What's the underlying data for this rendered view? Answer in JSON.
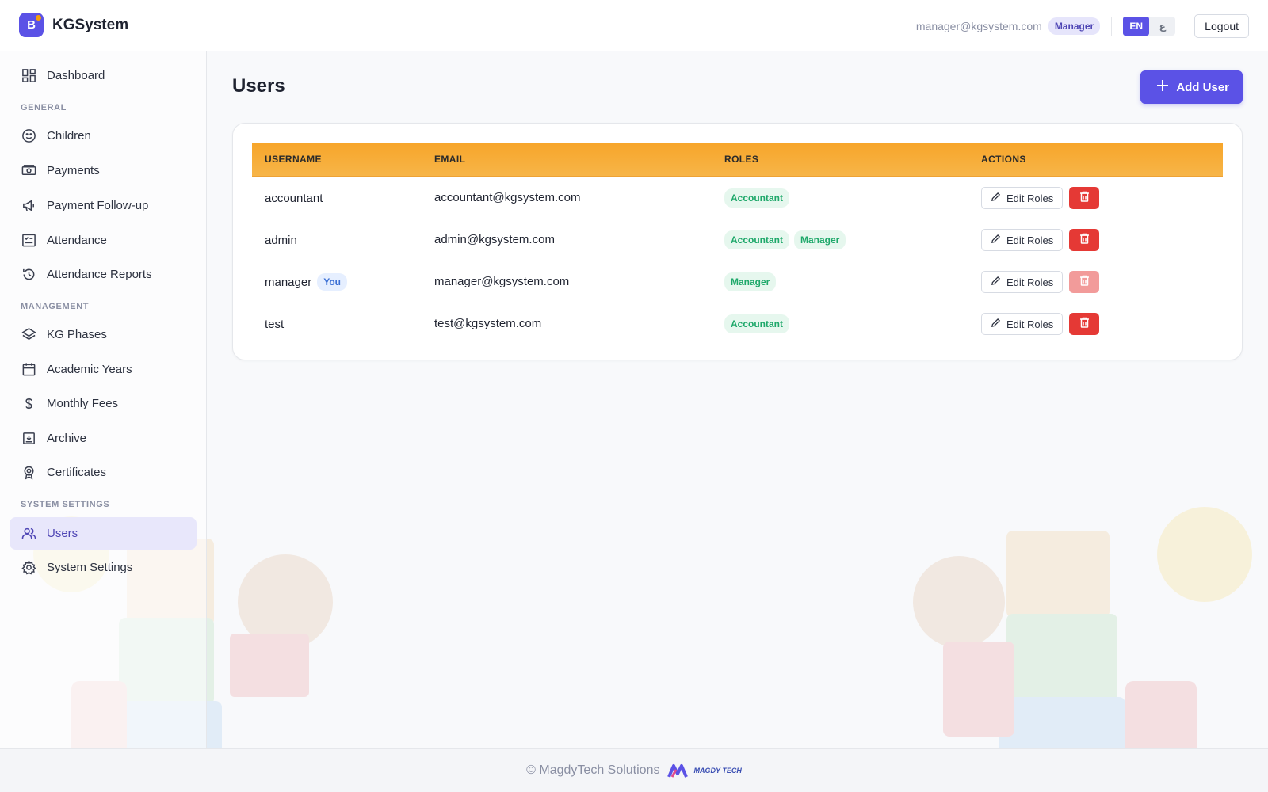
{
  "app": {
    "brand_letter": "B",
    "name": "KGSystem"
  },
  "header": {
    "user_email": "manager@kgsystem.com",
    "user_role": "Manager",
    "lang_en": "EN",
    "lang_ar": "ع",
    "logout_label": "Logout"
  },
  "sidebar": {
    "dashboard": "Dashboard",
    "sections": {
      "general": "GENERAL",
      "management": "MANAGEMENT",
      "system": "SYSTEM SETTINGS"
    },
    "items": {
      "children": "Children",
      "payments": "Payments",
      "payment_followup": "Payment Follow-up",
      "attendance": "Attendance",
      "attendance_reports": "Attendance Reports",
      "kg_phases": "KG Phases",
      "academic_years": "Academic Years",
      "monthly_fees": "Monthly Fees",
      "archive": "Archive",
      "certificates": "Certificates",
      "users": "Users",
      "system_settings": "System Settings"
    },
    "active_item": "users"
  },
  "main": {
    "title": "Users",
    "add_button": "Add User",
    "table": {
      "headers": {
        "username": "USERNAME",
        "email": "EMAIL",
        "roles": "ROLES",
        "actions": "ACTIONS"
      },
      "edit_label": "Edit Roles",
      "rows": [
        {
          "username": "accountant",
          "email": "accountant@kgsystem.com",
          "roles": [
            "Accountant"
          ],
          "is_you": false
        },
        {
          "username": "admin",
          "email": "admin@kgsystem.com",
          "roles": [
            "Accountant",
            "Manager"
          ],
          "is_you": false
        },
        {
          "username": "manager",
          "you_label": "You",
          "email": "manager@kgsystem.com",
          "roles": [
            "Manager"
          ],
          "is_you": true
        },
        {
          "username": "test",
          "email": "test@kgsystem.com",
          "roles": [
            "Accountant"
          ],
          "is_you": false
        }
      ]
    }
  },
  "footer": {
    "text": "© MagdyTech Solutions",
    "logo_text": "MAGDY TECH"
  },
  "colors": {
    "primary": "#5b52e6",
    "table_header": "#f7ac36",
    "danger": "#e53935",
    "role_green": "#1ea86a"
  }
}
